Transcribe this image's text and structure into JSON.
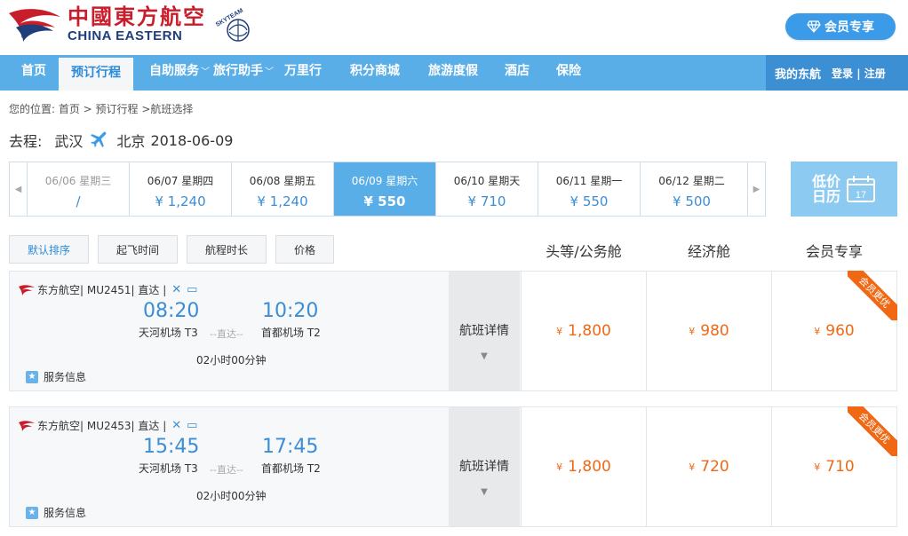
{
  "header": {
    "logo_cn": "中國東方航空",
    "logo_en": "CHINA EASTERN",
    "alliance": "SKYTEAM",
    "member_button": "会员专享"
  },
  "nav": {
    "items": [
      {
        "label": "首页",
        "caret": false
      },
      {
        "label": "预订行程",
        "caret": false,
        "active": true
      },
      {
        "label": "自助服务",
        "caret": true
      },
      {
        "label": "旅行助手",
        "caret": true
      },
      {
        "label": "万里行",
        "caret": false
      },
      {
        "label": "积分商城",
        "caret": false
      },
      {
        "label": "旅游度假",
        "caret": false
      },
      {
        "label": "酒店",
        "caret": false
      },
      {
        "label": "保险",
        "caret": false
      }
    ],
    "my_account": "我的东航",
    "login": "登录 | 注册"
  },
  "breadcrumb": "您的位置:  首页 > 预订行程 >航班选择",
  "route": {
    "label": "去程:",
    "from": "武汉",
    "to": "北京",
    "date": "2018-06-09"
  },
  "dates": [
    {
      "date": "06/06 星期三",
      "price": "/",
      "state": "past"
    },
    {
      "date": "06/07 星期四",
      "price": "¥ 1,240"
    },
    {
      "date": "06/08 星期五",
      "price": "¥ 1,240"
    },
    {
      "date": "06/09 星期六",
      "price": "¥ 550",
      "state": "selected"
    },
    {
      "date": "06/10 星期天",
      "price": "¥ 710"
    },
    {
      "date": "06/11 星期一",
      "price": "¥ 550"
    },
    {
      "date": "06/12 星期二",
      "price": "¥ 500"
    }
  ],
  "calendar": {
    "label": "低价日历",
    "day": "17"
  },
  "sort": {
    "default": "默认排序",
    "departure": "起飞时间",
    "duration": "航程时长",
    "price": "价格"
  },
  "columns": {
    "first": "头等/公务舱",
    "economy": "经济舱",
    "member": "会员专享"
  },
  "flights": [
    {
      "airline": "东方航空| MU2451| 直达 |",
      "dep_time": "08:20",
      "arr_time": "10:20",
      "dep_airport": "天河机场 T3",
      "arr_airport": "首都机场 T2",
      "direct": "--直达--",
      "duration": "02小时00分钟",
      "service": "服务信息",
      "detail": "航班详情",
      "first_price": "1,800",
      "economy_price": "980",
      "member_price": "960",
      "ribbon": "会员更优"
    },
    {
      "airline": "东方航空| MU2453| 直达 |",
      "dep_time": "15:45",
      "arr_time": "17:45",
      "dep_airport": "天河机场 T3",
      "arr_airport": "首都机场 T2",
      "direct": "--直达--",
      "duration": "02小时00分钟",
      "service": "服务信息",
      "detail": "航班详情",
      "first_price": "1,800",
      "economy_price": "720",
      "member_price": "710",
      "ribbon": "会员更优"
    }
  ],
  "currency": "¥",
  "colors": {
    "nav": "#5aaee8",
    "accent_blue": "#3b8ed6",
    "price_orange": "#f06814",
    "brand_red": "#c81e2c"
  }
}
